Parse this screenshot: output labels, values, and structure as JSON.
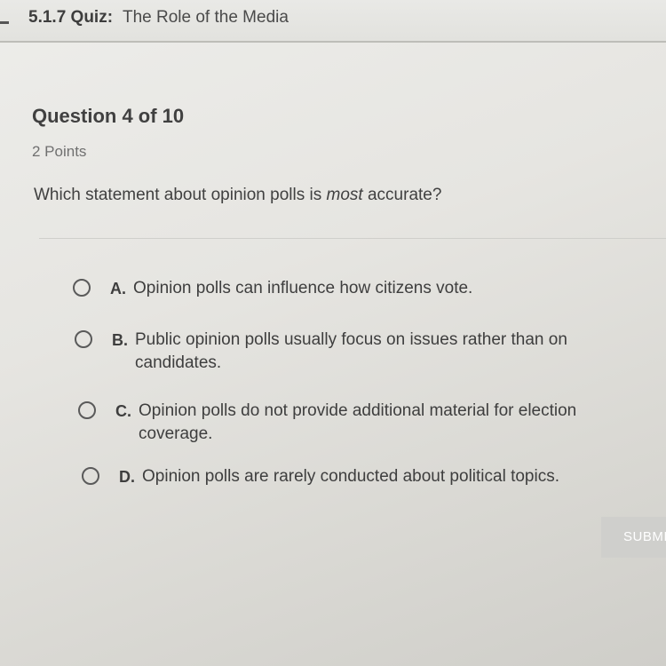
{
  "header": {
    "quiz_number": "5.1.7",
    "quiz_kind": "Quiz:",
    "quiz_title": "The Role of the Media"
  },
  "question": {
    "heading": "Question 4 of 10",
    "points": "2 Points",
    "prompt_before": "Which statement about opinion polls is ",
    "prompt_emphasis": "most",
    "prompt_after": " accurate?"
  },
  "options": [
    {
      "letter": "A.",
      "text": "Opinion polls can influence how citizens vote."
    },
    {
      "letter": "B.",
      "text": "Public opinion polls usually focus on issues rather than on candidates."
    },
    {
      "letter": "C.",
      "text": "Opinion polls do not provide additional material for election coverage."
    },
    {
      "letter": "D.",
      "text": "Opinion polls are rarely conducted about political topics."
    }
  ],
  "submit": {
    "label": "SUBMIT"
  }
}
